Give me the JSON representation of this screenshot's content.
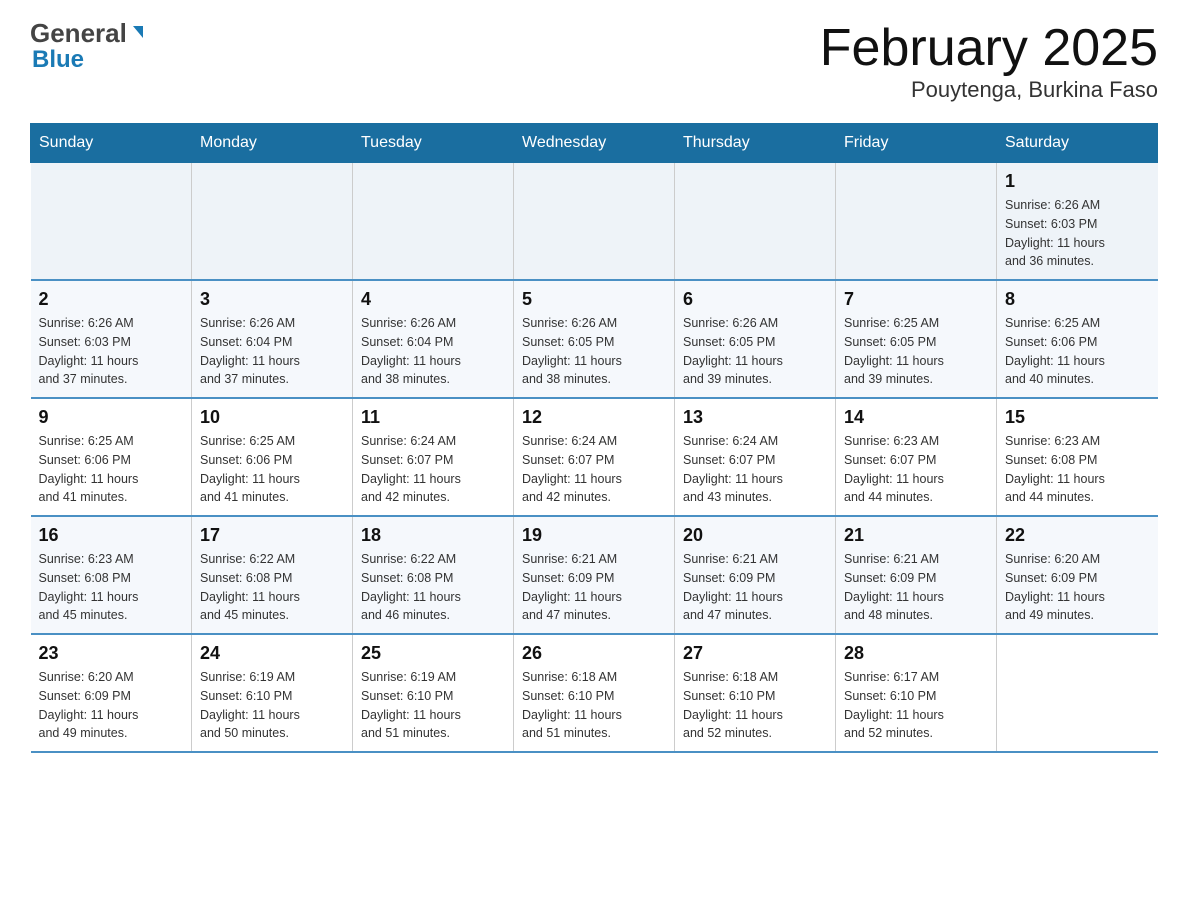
{
  "header": {
    "logo_general": "General",
    "logo_blue": "Blue",
    "title": "February 2025",
    "subtitle": "Pouytenga, Burkina Faso"
  },
  "weekdays": [
    "Sunday",
    "Monday",
    "Tuesday",
    "Wednesday",
    "Thursday",
    "Friday",
    "Saturday"
  ],
  "accent_color": "#1a6ea0",
  "weeks": [
    {
      "days": [
        {
          "num": "",
          "info": ""
        },
        {
          "num": "",
          "info": ""
        },
        {
          "num": "",
          "info": ""
        },
        {
          "num": "",
          "info": ""
        },
        {
          "num": "",
          "info": ""
        },
        {
          "num": "",
          "info": ""
        },
        {
          "num": "1",
          "info": "Sunrise: 6:26 AM\nSunset: 6:03 PM\nDaylight: 11 hours\nand 36 minutes."
        }
      ]
    },
    {
      "days": [
        {
          "num": "2",
          "info": "Sunrise: 6:26 AM\nSunset: 6:03 PM\nDaylight: 11 hours\nand 37 minutes."
        },
        {
          "num": "3",
          "info": "Sunrise: 6:26 AM\nSunset: 6:04 PM\nDaylight: 11 hours\nand 37 minutes."
        },
        {
          "num": "4",
          "info": "Sunrise: 6:26 AM\nSunset: 6:04 PM\nDaylight: 11 hours\nand 38 minutes."
        },
        {
          "num": "5",
          "info": "Sunrise: 6:26 AM\nSunset: 6:05 PM\nDaylight: 11 hours\nand 38 minutes."
        },
        {
          "num": "6",
          "info": "Sunrise: 6:26 AM\nSunset: 6:05 PM\nDaylight: 11 hours\nand 39 minutes."
        },
        {
          "num": "7",
          "info": "Sunrise: 6:25 AM\nSunset: 6:05 PM\nDaylight: 11 hours\nand 39 minutes."
        },
        {
          "num": "8",
          "info": "Sunrise: 6:25 AM\nSunset: 6:06 PM\nDaylight: 11 hours\nand 40 minutes."
        }
      ]
    },
    {
      "days": [
        {
          "num": "9",
          "info": "Sunrise: 6:25 AM\nSunset: 6:06 PM\nDaylight: 11 hours\nand 41 minutes."
        },
        {
          "num": "10",
          "info": "Sunrise: 6:25 AM\nSunset: 6:06 PM\nDaylight: 11 hours\nand 41 minutes."
        },
        {
          "num": "11",
          "info": "Sunrise: 6:24 AM\nSunset: 6:07 PM\nDaylight: 11 hours\nand 42 minutes."
        },
        {
          "num": "12",
          "info": "Sunrise: 6:24 AM\nSunset: 6:07 PM\nDaylight: 11 hours\nand 42 minutes."
        },
        {
          "num": "13",
          "info": "Sunrise: 6:24 AM\nSunset: 6:07 PM\nDaylight: 11 hours\nand 43 minutes."
        },
        {
          "num": "14",
          "info": "Sunrise: 6:23 AM\nSunset: 6:07 PM\nDaylight: 11 hours\nand 44 minutes."
        },
        {
          "num": "15",
          "info": "Sunrise: 6:23 AM\nSunset: 6:08 PM\nDaylight: 11 hours\nand 44 minutes."
        }
      ]
    },
    {
      "days": [
        {
          "num": "16",
          "info": "Sunrise: 6:23 AM\nSunset: 6:08 PM\nDaylight: 11 hours\nand 45 minutes."
        },
        {
          "num": "17",
          "info": "Sunrise: 6:22 AM\nSunset: 6:08 PM\nDaylight: 11 hours\nand 45 minutes."
        },
        {
          "num": "18",
          "info": "Sunrise: 6:22 AM\nSunset: 6:08 PM\nDaylight: 11 hours\nand 46 minutes."
        },
        {
          "num": "19",
          "info": "Sunrise: 6:21 AM\nSunset: 6:09 PM\nDaylight: 11 hours\nand 47 minutes."
        },
        {
          "num": "20",
          "info": "Sunrise: 6:21 AM\nSunset: 6:09 PM\nDaylight: 11 hours\nand 47 minutes."
        },
        {
          "num": "21",
          "info": "Sunrise: 6:21 AM\nSunset: 6:09 PM\nDaylight: 11 hours\nand 48 minutes."
        },
        {
          "num": "22",
          "info": "Sunrise: 6:20 AM\nSunset: 6:09 PM\nDaylight: 11 hours\nand 49 minutes."
        }
      ]
    },
    {
      "days": [
        {
          "num": "23",
          "info": "Sunrise: 6:20 AM\nSunset: 6:09 PM\nDaylight: 11 hours\nand 49 minutes."
        },
        {
          "num": "24",
          "info": "Sunrise: 6:19 AM\nSunset: 6:10 PM\nDaylight: 11 hours\nand 50 minutes."
        },
        {
          "num": "25",
          "info": "Sunrise: 6:19 AM\nSunset: 6:10 PM\nDaylight: 11 hours\nand 51 minutes."
        },
        {
          "num": "26",
          "info": "Sunrise: 6:18 AM\nSunset: 6:10 PM\nDaylight: 11 hours\nand 51 minutes."
        },
        {
          "num": "27",
          "info": "Sunrise: 6:18 AM\nSunset: 6:10 PM\nDaylight: 11 hours\nand 52 minutes."
        },
        {
          "num": "28",
          "info": "Sunrise: 6:17 AM\nSunset: 6:10 PM\nDaylight: 11 hours\nand 52 minutes."
        },
        {
          "num": "",
          "info": ""
        }
      ]
    }
  ]
}
